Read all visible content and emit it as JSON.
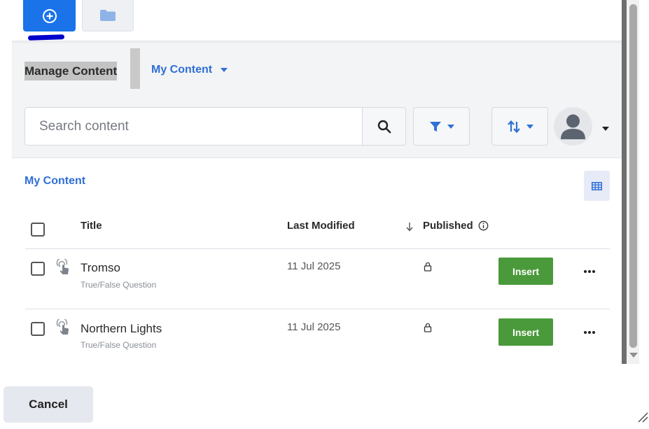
{
  "breadcrumb": {
    "root_label": "Manage Content",
    "current_label": "My Content"
  },
  "search": {
    "placeholder": "Search content",
    "value": ""
  },
  "section": {
    "title": "My Content"
  },
  "table": {
    "columns": {
      "title": "Title",
      "last_modified": "Last Modified",
      "published": "Published"
    },
    "rows": [
      {
        "title": "Tromso",
        "type": "True/False Question",
        "last_modified": "11 Jul 2025",
        "action_label": "Insert"
      },
      {
        "title": "Northern Lights",
        "type": "True/False Question",
        "last_modified": "11 Jul 2025",
        "action_label": "Insert"
      }
    ]
  },
  "footer": {
    "cancel_label": "Cancel"
  },
  "colors": {
    "primary": "#1a73e8",
    "link": "#2f6fd6",
    "insert": "#4a9a3b",
    "panel_bg": "#f3f4f6"
  },
  "icons": {
    "tab_add": "plus-circle-icon",
    "tab_folder": "folder-icon",
    "search": "search-icon",
    "filter": "filter-icon",
    "sort": "sort-icon",
    "avatar": "user-avatar-icon",
    "grid": "table-grid-icon",
    "sort_direction": "arrow-down-icon",
    "info": "info-icon",
    "content_type": "touch-icon",
    "published": "lock-icon",
    "more": "more-horizontal-icon"
  }
}
